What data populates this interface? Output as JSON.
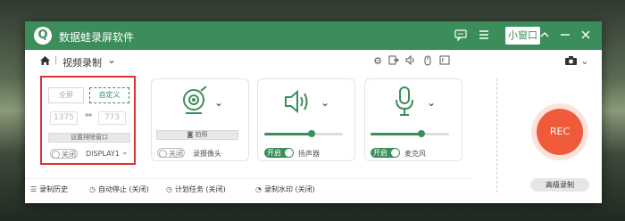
{
  "app": {
    "title": "数据蛙录屏软件",
    "logo": "Q"
  },
  "titlebar": {
    "chat_icon": "chat-bubble-icon",
    "menu_icon": "menu-icon",
    "mini_window": "小窗口",
    "minimize_icon": "minimize-icon",
    "close_icon": "close-icon"
  },
  "toolbar": {
    "mode": "视频录制",
    "sep": "|"
  },
  "screen": {
    "fullscreen": "全屏",
    "custom": "自定义",
    "width": "1375",
    "height": "773",
    "exclude_window": "设置排除窗口",
    "toggle": "关闭",
    "display": "DISPLAY1"
  },
  "camera": {
    "button": "拍照",
    "toggle": "关闭",
    "label": "录摄像头"
  },
  "speaker": {
    "toggle": "开启",
    "label": "扬声器",
    "volume": 0.6
  },
  "mic": {
    "toggle": "开启",
    "label": "麦克风",
    "volume": 0.65
  },
  "record": {
    "rec": "REC",
    "advanced": "高级录制"
  },
  "bottom": {
    "history": "录制历史",
    "autostop": "自动停止 (关闭)",
    "schedule": "计划任务 (关闭)",
    "watermark": "录制水印 (关闭)"
  },
  "colors": {
    "accent": "#3b8e5b",
    "rec": "#ef5a3a",
    "highlight": "#e03030"
  }
}
